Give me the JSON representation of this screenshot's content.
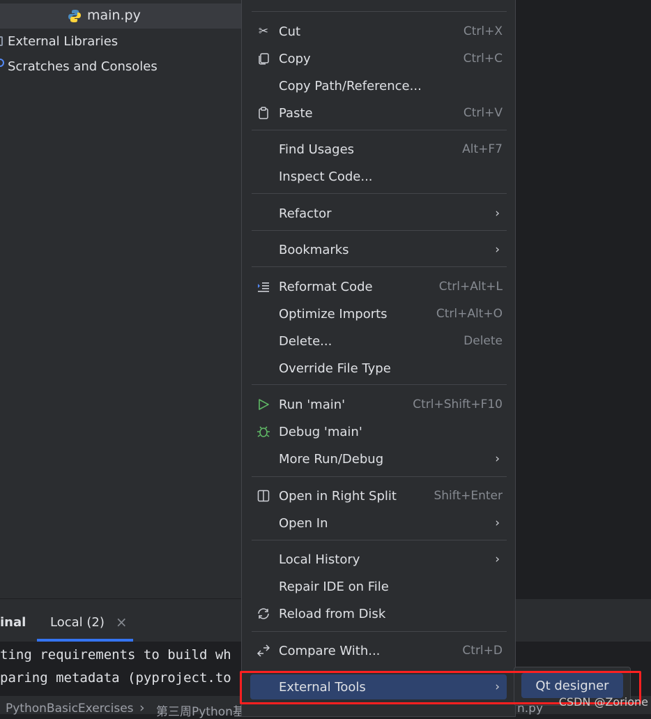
{
  "project_tree": {
    "selected_file": "main.py",
    "items": [
      {
        "label": "External Libraries",
        "icon": "library-icon"
      },
      {
        "label": "Scratches and Consoles",
        "icon": "scratches-icon"
      }
    ]
  },
  "context_menu": {
    "items": [
      {
        "label": "Cut",
        "shortcut": "Ctrl+X",
        "icon": "scissors-icon"
      },
      {
        "label": "Copy",
        "shortcut": "Ctrl+C",
        "icon": "copy-icon"
      },
      {
        "label": "Copy Path/Reference..."
      },
      {
        "label": "Paste",
        "shortcut": "Ctrl+V",
        "icon": "clipboard-icon"
      },
      {
        "label": "Find Usages",
        "shortcut": "Alt+F7"
      },
      {
        "label": "Inspect Code..."
      },
      {
        "label": "Refactor",
        "submenu": true
      },
      {
        "label": "Bookmarks",
        "submenu": true
      },
      {
        "label": "Reformat Code",
        "shortcut": "Ctrl+Alt+L",
        "icon": "reformat-icon"
      },
      {
        "label": "Optimize Imports",
        "shortcut": "Ctrl+Alt+O"
      },
      {
        "label": "Delete...",
        "shortcut": "Delete"
      },
      {
        "label": "Override File Type"
      },
      {
        "label": "Run 'main'",
        "shortcut": "Ctrl+Shift+F10",
        "icon": "run-icon"
      },
      {
        "label": "Debug 'main'",
        "icon": "debug-icon"
      },
      {
        "label": "More Run/Debug",
        "submenu": true
      },
      {
        "label": "Open in Right Split",
        "shortcut": "Shift+Enter",
        "icon": "split-icon"
      },
      {
        "label": "Open In",
        "submenu": true
      },
      {
        "label": "Local History",
        "submenu": true
      },
      {
        "label": "Repair IDE on File"
      },
      {
        "label": "Reload from Disk",
        "icon": "reload-icon"
      },
      {
        "label": "Compare With...",
        "shortcut": "Ctrl+D",
        "icon": "compare-icon"
      },
      {
        "label": "External Tools",
        "submenu": true,
        "highlighted": true
      }
    ],
    "arrow_glyph": "›"
  },
  "submenu": {
    "item": "Qt designer"
  },
  "tool_window": {
    "tab_partial": "inal",
    "tab_local": "Local (2)",
    "close_glyph": "×"
  },
  "terminal": {
    "lines": [
      "ting requirements to build wh",
      "paring metadata (pyproject.to"
    ]
  },
  "statusbar": {
    "breadcrumb_project": "PythonBasicExercises",
    "breadcrumb_sep": "›",
    "breadcrumb_folder": "第三周Python基",
    "file_fragment": "n.py"
  },
  "watermark": "CSDN @Zorione",
  "colors": {
    "accent": "#3574f0",
    "highlight": "#2e436e",
    "annotation": "#ff2020"
  }
}
